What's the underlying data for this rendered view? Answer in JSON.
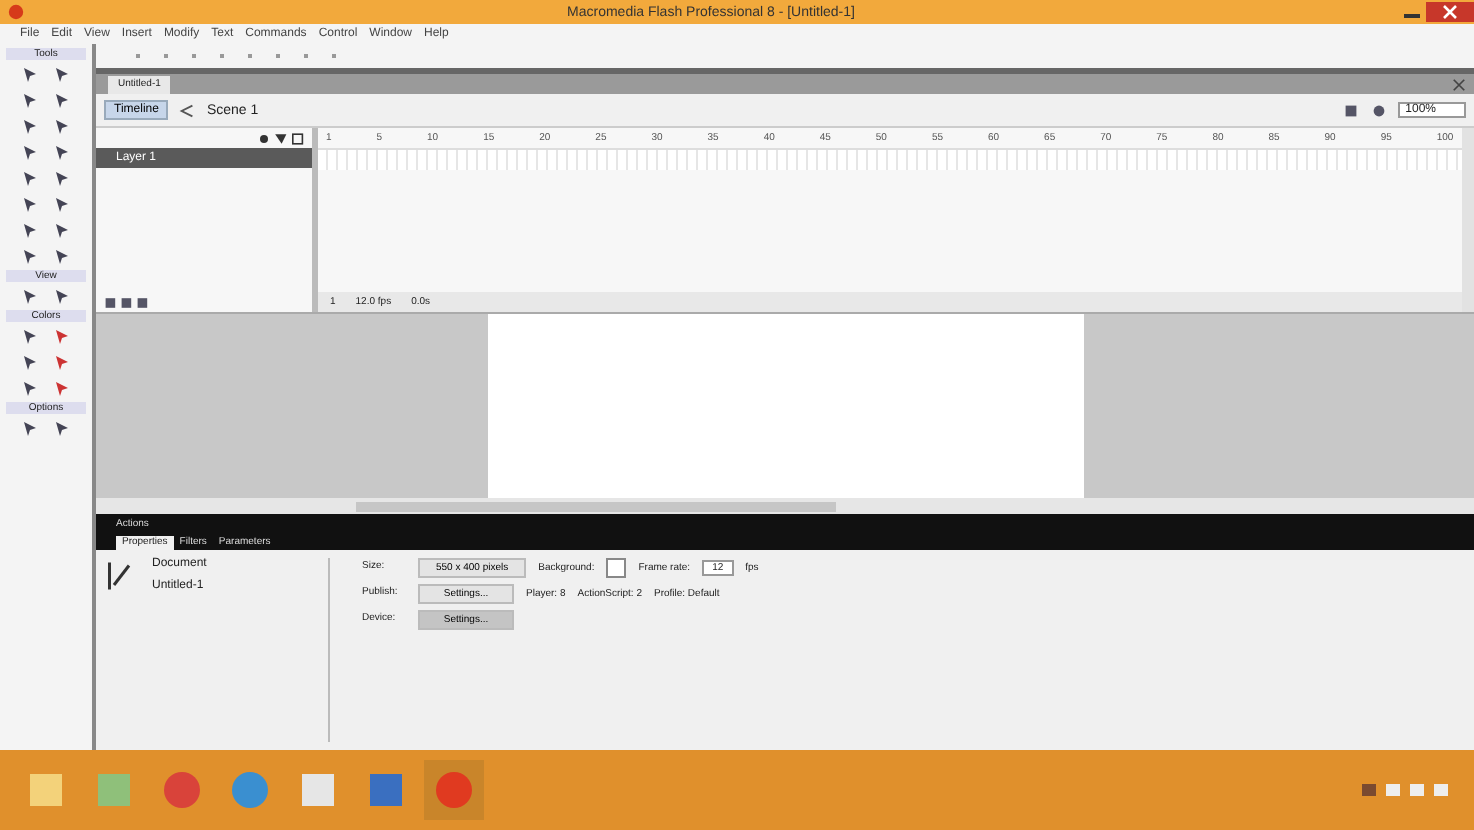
{
  "window": {
    "title": "Macromedia Flash Professional 8 - [Untitled-1]"
  },
  "menu": [
    "File",
    "Edit",
    "View",
    "Insert",
    "Modify",
    "Text",
    "Commands",
    "Control",
    "Window",
    "Help"
  ],
  "document_tab": {
    "label": "Untitled-1"
  },
  "tools": {
    "sections": [
      {
        "label": "Tools"
      },
      {
        "label": "View"
      },
      {
        "label": "Colors"
      },
      {
        "label": "Options"
      }
    ]
  },
  "timeline": {
    "button": "Timeline",
    "scene": "Scene 1",
    "zoom": "100%",
    "frames": [
      "1",
      "5",
      "10",
      "15",
      "20",
      "25",
      "30",
      "35",
      "40",
      "45",
      "50",
      "55",
      "60",
      "65",
      "70",
      "75",
      "80",
      "85",
      "90",
      "95",
      "100"
    ],
    "layers": [
      {
        "name": "Layer 1",
        "selected": true
      }
    ],
    "status": [
      "1",
      "12.0 fps",
      "0.0s"
    ]
  },
  "panels": {
    "actions": "Actions",
    "tabs": [
      {
        "label": "Properties",
        "selected": true
      },
      {
        "label": "Filters",
        "selected": false
      },
      {
        "label": "Parameters",
        "selected": false
      }
    ]
  },
  "properties": {
    "type": "Document",
    "name": "Untitled-1",
    "size_label": "Size:",
    "size": "550 x 400 pixels",
    "background_label": "Background:",
    "frame_rate_label": "Frame rate:",
    "frame_rate": "12",
    "fps": "fps",
    "publish_label": "Publish:",
    "publish_button": "Settings...",
    "player": "Player: 8",
    "actionscript": "ActionScript: 2",
    "profile": "Profile: Default",
    "device_label": "Device:",
    "device_button": "Settings..."
  },
  "taskbar": {
    "apps": [
      {
        "kind": "explorer",
        "active": false
      },
      {
        "kind": "paint",
        "active": false
      },
      {
        "kind": "chrome",
        "active": false
      },
      {
        "kind": "media",
        "active": false
      },
      {
        "kind": "word",
        "active": false
      },
      {
        "kind": "document",
        "active": false
      },
      {
        "kind": "flash",
        "active": true
      }
    ]
  }
}
